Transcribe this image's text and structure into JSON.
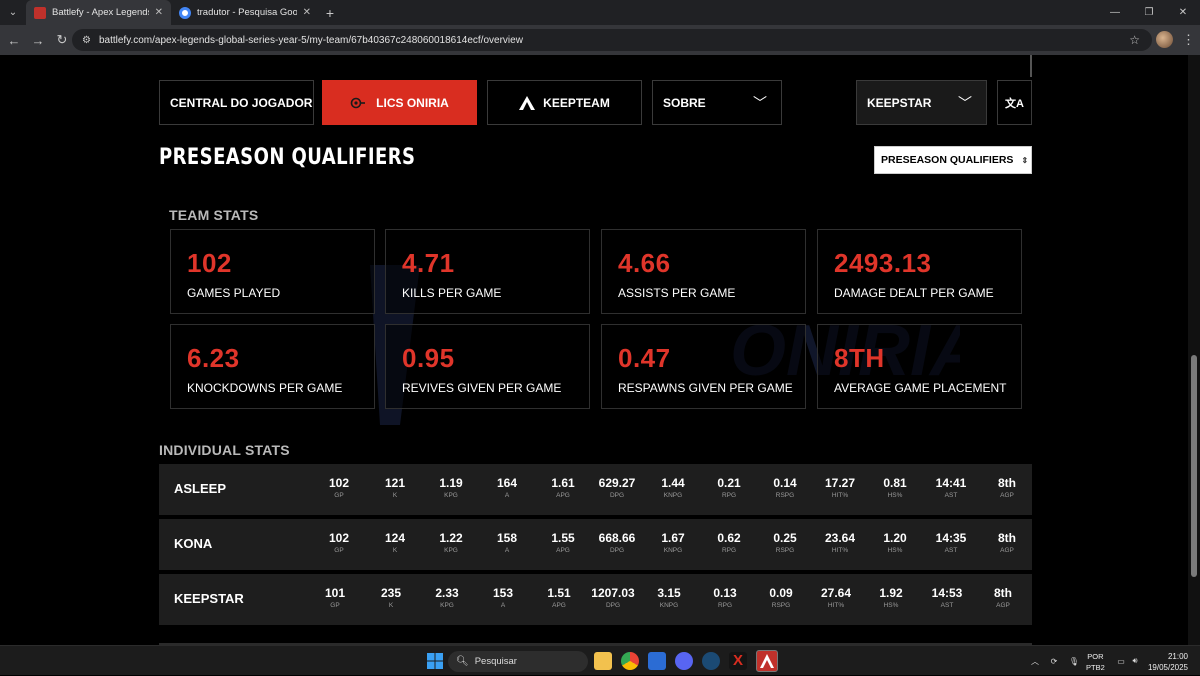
{
  "browser": {
    "tabs": [
      {
        "title": "Battlefy - Apex Legends Global",
        "active": true
      },
      {
        "title": "tradutor - Pesquisa Google",
        "active": false
      }
    ],
    "url": "battlefy.com/apex-legends-global-series-year-5/my-team/67b40367c248060018614ecf/overview"
  },
  "nav": {
    "player_hub": "CENTRAL DO JOGADOR",
    "team": "LICS ONIRIA",
    "org": "KEEPTEAM",
    "about": "SOBRE",
    "user": "KEEPSTAR"
  },
  "page_title": "PRESEASON QUALIFIERS",
  "stage_select": "PRESEASON QUALIFIERS",
  "team_stats_title": "TEAM STATS",
  "team_stats": [
    {
      "value": "102",
      "label": "GAMES PLAYED"
    },
    {
      "value": "4.71",
      "label": "KILLS PER GAME"
    },
    {
      "value": "4.66",
      "label": "ASSISTS PER GAME"
    },
    {
      "value": "2493.13",
      "label": "DAMAGE DEALT PER GAME"
    },
    {
      "value": "6.23",
      "label": "KNOCKDOWNS PER GAME"
    },
    {
      "value": "0.95",
      "label": "REVIVES GIVEN PER GAME"
    },
    {
      "value": "0.47",
      "label": "RESPAWNS GIVEN PER GAME"
    },
    {
      "value": "8TH",
      "label": "AVERAGE GAME PLACEMENT"
    }
  ],
  "individual_stats_title": "INDIVIDUAL STATS",
  "stat_keys": [
    "GP",
    "K",
    "KPG",
    "A",
    "APG",
    "DPG",
    "KNPG",
    "RPG",
    "RSPG",
    "HIT%",
    "HS%",
    "AST",
    "AGP"
  ],
  "players": [
    {
      "name": "ASLEEP",
      "stats": [
        "102",
        "121",
        "1.19",
        "164",
        "1.61",
        "629.27",
        "1.44",
        "0.21",
        "0.14",
        "17.27",
        "0.81",
        "14:41",
        "8th"
      ]
    },
    {
      "name": "KONA",
      "stats": [
        "102",
        "124",
        "1.22",
        "158",
        "1.55",
        "668.66",
        "1.67",
        "0.62",
        "0.25",
        "23.64",
        "1.20",
        "14:35",
        "8th"
      ]
    },
    {
      "name": "KEEPSTAR",
      "stats": [
        "101",
        "235",
        "2.33",
        "153",
        "1.51",
        "1207.03",
        "3.15",
        "0.13",
        "0.09",
        "27.64",
        "1.92",
        "14:53",
        "8th"
      ]
    }
  ],
  "taskbar": {
    "search_placeholder": "Pesquisar",
    "lang": "POR",
    "layout": "PTB2",
    "time": "21:00",
    "date": "19/05/2025"
  },
  "colors": {
    "accent": "#d92d20",
    "stat_value": "#e0352a"
  }
}
